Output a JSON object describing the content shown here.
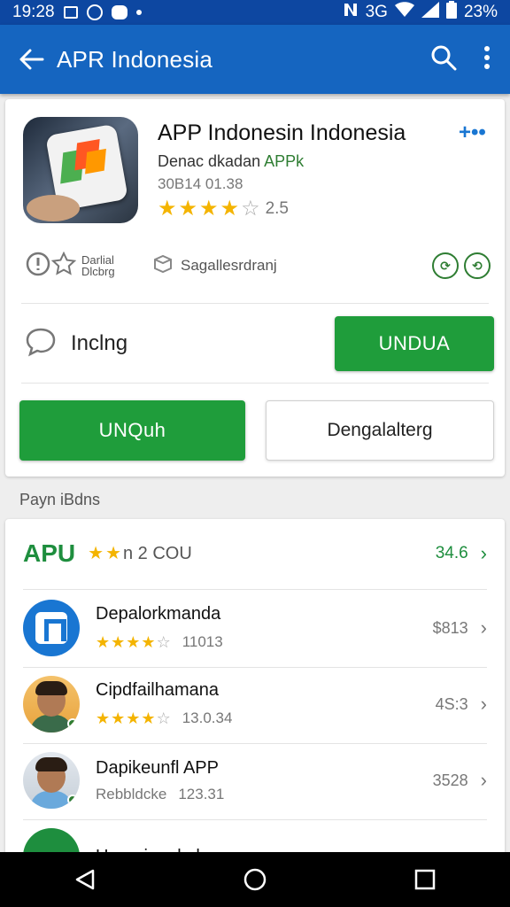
{
  "status_bar": {
    "time": "19:28",
    "battery": "23%",
    "network": "3G"
  },
  "appbar": {
    "title": "APR Indonesia"
  },
  "app": {
    "title": "APP Indonesin Indonesia",
    "developer_prefix": "Denac dkadan ",
    "developer_accent": "APPk",
    "meta": "30B14 01.38",
    "rating_value": "2.5",
    "rating_stars": 4,
    "more_label": "+••"
  },
  "info": {
    "label_small": "Darlial Dlcbrg",
    "label": "Sagallesrdranj"
  },
  "incl_row": {
    "label": "Inclng",
    "button": "UNDUA"
  },
  "buttons": {
    "primary": "UNQuh",
    "secondary": "Dengalalterg"
  },
  "section_label": "Payn iBdns",
  "featured": {
    "name": "APU",
    "rating_text": "n 2  COU",
    "price": "34.6"
  },
  "list": [
    {
      "name": "Depalorkmanda",
      "count": "11013",
      "price": "$813",
      "stars": 4
    },
    {
      "name": "Cipdfailhamana",
      "count": "13.0.34",
      "price": "4S:3",
      "stars": 4
    },
    {
      "name": "Dapikeunfl APP",
      "sub": "Rebbldcke",
      "count": "123.31",
      "price": "3528"
    },
    {
      "name": "Upprpimmkalpap"
    }
  ],
  "colors": {
    "appbar": "#1565c0",
    "accent_green": "#1f9d3b",
    "star": "#f4b400"
  }
}
